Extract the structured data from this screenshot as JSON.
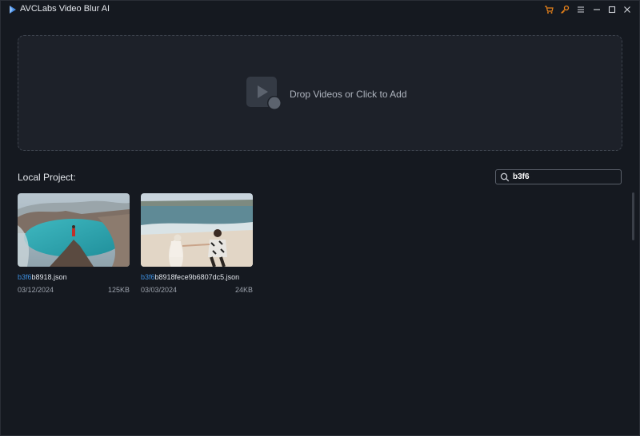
{
  "window": {
    "title": "AVCLabs Video Blur AI",
    "accent_color": "#e8821a",
    "icons": [
      "app-logo-icon",
      "cart-icon",
      "key-icon",
      "menu-icon",
      "minimize-icon",
      "maximize-icon",
      "close-icon"
    ]
  },
  "dropzone": {
    "label": "Drop Videos or Click to Add",
    "icon": "video-add-icon"
  },
  "projects": {
    "title": "Local Project:",
    "search_value": "b3f6",
    "highlight_color": "#3d8fe0",
    "items": [
      {
        "name_match": "b3f6",
        "name_rest": "b8918.json",
        "date": "03/12/2024",
        "size": "125KB",
        "thumbnail": "volcano-crater-lake-photo"
      },
      {
        "name_match": "b3f6",
        "name_rest": "b8918fece9b6807dc5.json",
        "date": "03/03/2024",
        "size": "24KB",
        "thumbnail": "beach-couple-photo"
      }
    ]
  }
}
